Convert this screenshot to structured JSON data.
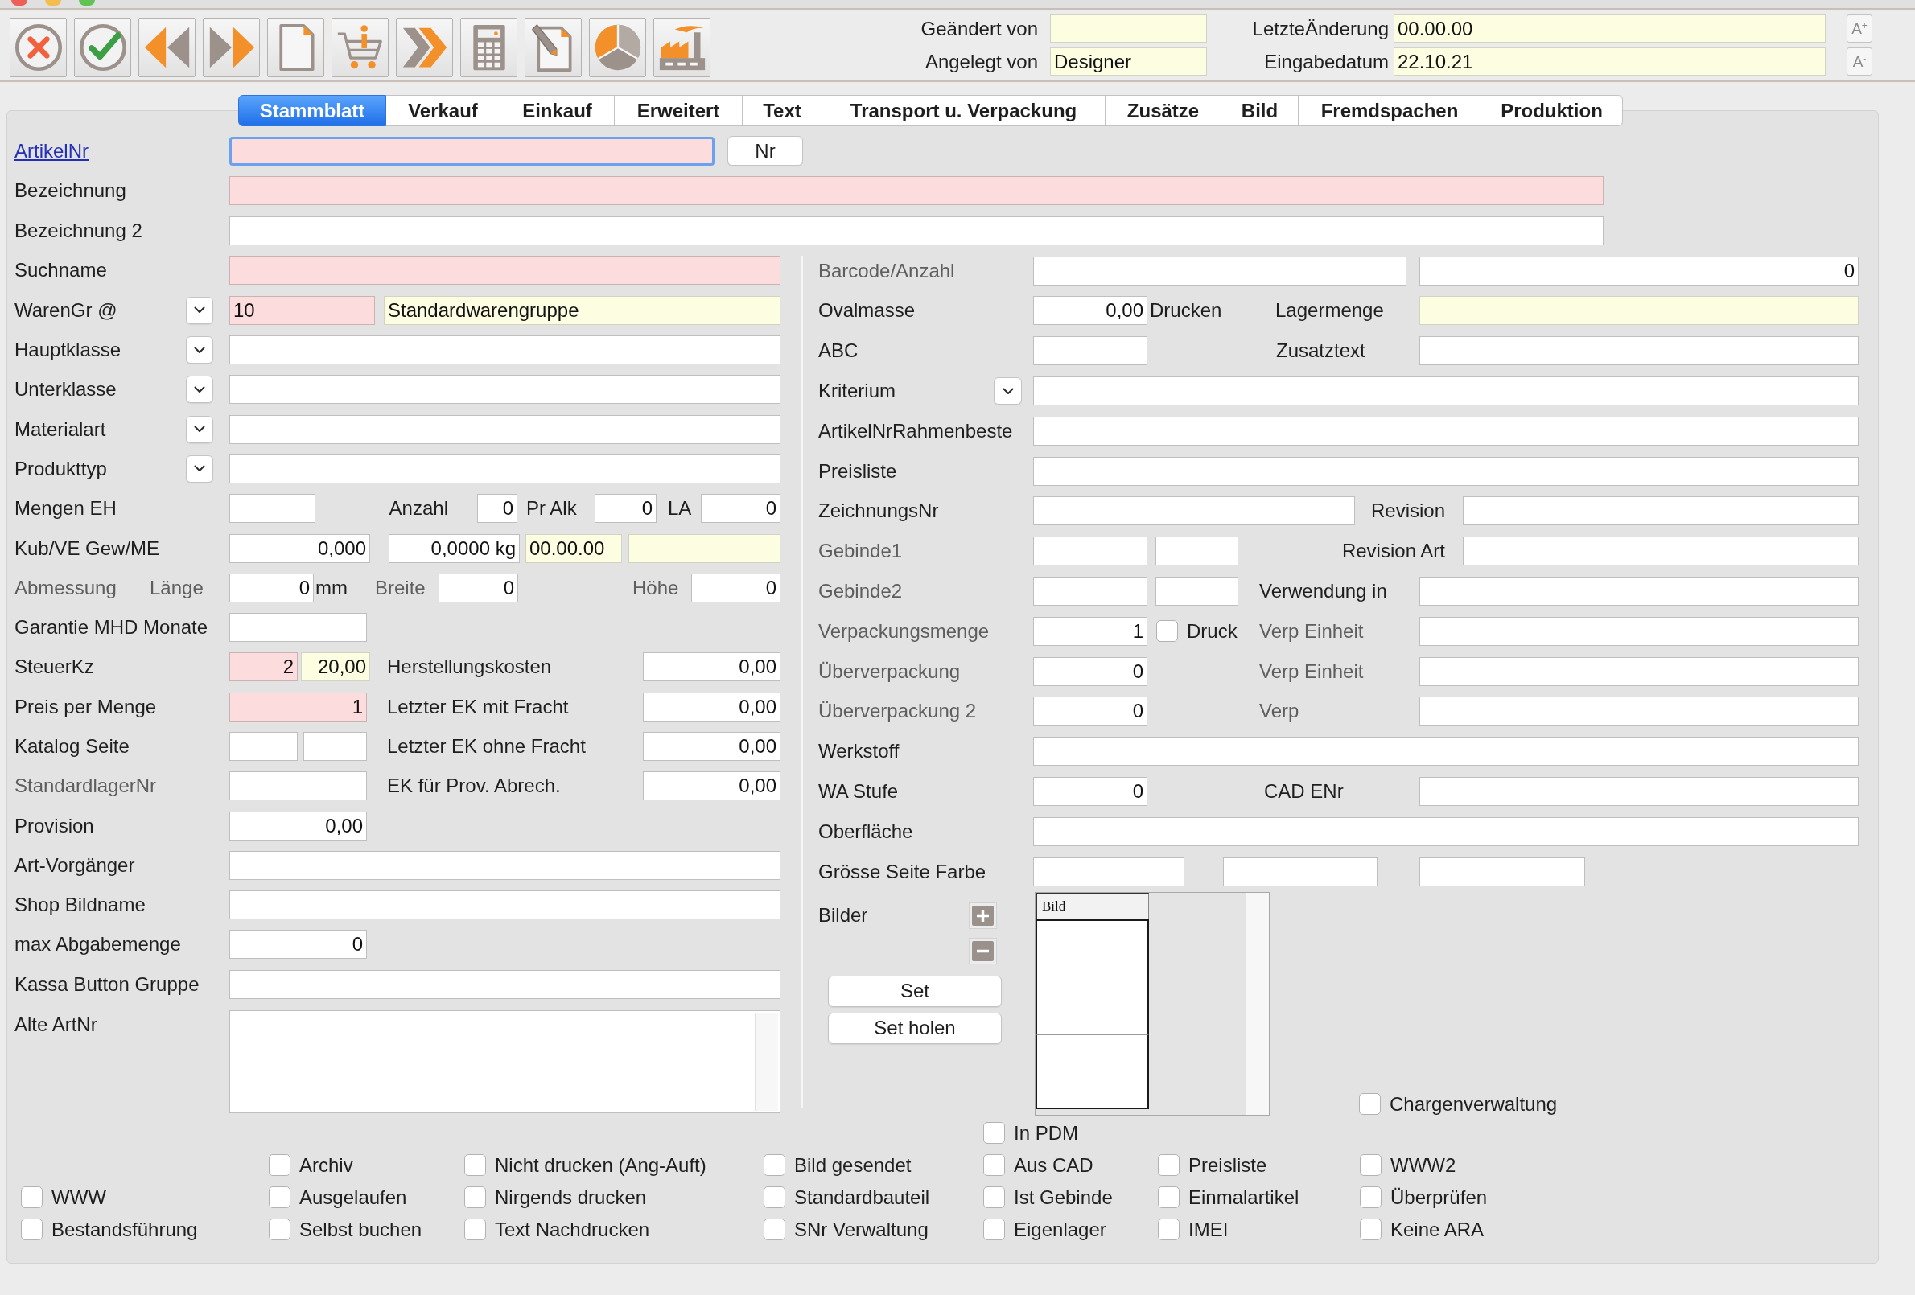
{
  "toolbar": [
    {
      "kind": "cancel"
    },
    {
      "kind": "confirm"
    },
    {
      "kind": "back"
    },
    {
      "kind": "forward"
    },
    {
      "kind": "new"
    },
    {
      "kind": "shop"
    },
    {
      "kind": "next"
    },
    {
      "kind": "calculator"
    },
    {
      "kind": "edit"
    },
    {
      "kind": "chart"
    },
    {
      "kind": "production"
    }
  ],
  "record_info": [
    [
      {
        "label": "Geändert von",
        "readonly": true
      },
      {
        "label": "LetzteÄnderung",
        "value": "00.00.00",
        "readonly": true
      }
    ],
    [
      {
        "label": "Angelegt von",
        "value": "Designer",
        "readonly": true
      },
      {
        "label": "Eingabedatum",
        "value": "22.10.21",
        "readonly": true
      }
    ]
  ],
  "font_buttons": [
    "A$^{+}$",
    "A$^{-}$"
  ],
  "tabs": [
    {
      "label": "Stammblatt",
      "selected": true
    },
    {
      "label": "Verkauf",
      "selected": false
    },
    {
      "label": "Einkauf",
      "selected": false
    },
    {
      "label": "Erweitert",
      "selected": false
    },
    {
      "label": "Text",
      "selected": false
    },
    {
      "label": "Transport u. Verpackung",
      "selected": false
    },
    {
      "label": "Zusätze",
      "selected": false
    },
    {
      "label": "Bild",
      "selected": false
    },
    {
      "label": "Fremdspachen",
      "selected": false
    },
    {
      "label": "Produktion",
      "selected": false
    }
  ],
  "form": {
    "top_rows": [
      {
        "items": [
          {
            "kind": "link",
            "text": "ArtikelNr"
          },
          {
            "kind": "text",
            "required": true,
            "readonly": false,
            "focused": true
          },
          {
            "kind": "button",
            "label": "Nr"
          }
        ]
      },
      {
        "items": [
          {
            "kind": "label",
            "text": "Bezeichnung",
            "dim": false
          },
          {
            "kind": "text",
            "required": true,
            "readonly": false
          }
        ]
      },
      {
        "items": [
          {
            "kind": "label",
            "text": "Bezeichnung 2",
            "dim": false
          },
          {
            "kind": "text",
            "required": false,
            "readonly": false
          }
        ]
      }
    ],
    "left_rows": [
      {
        "items": [
          {
            "kind": "label",
            "text": "Suchname",
            "dim": false
          },
          {
            "kind": "text",
            "required": true,
            "readonly": false
          }
        ]
      },
      {
        "items": [
          {
            "kind": "label",
            "text": "WarenGr @",
            "dim": false
          },
          {
            "kind": "dropdown"
          },
          {
            "kind": "text",
            "value": "10",
            "required": true,
            "readonly": false
          },
          {
            "kind": "text",
            "value": "Standardwarengruppe",
            "required": false,
            "readonly": true
          }
        ]
      },
      {
        "items": [
          {
            "kind": "label",
            "text": "Hauptklasse",
            "dim": false
          },
          {
            "kind": "dropdown"
          },
          {
            "kind": "text",
            "required": false,
            "readonly": false
          }
        ]
      },
      {
        "items": [
          {
            "kind": "label",
            "text": "Unterklasse",
            "dim": false
          },
          {
            "kind": "dropdown"
          },
          {
            "kind": "text",
            "required": false,
            "readonly": false
          }
        ]
      },
      {
        "items": [
          {
            "kind": "label",
            "text": "Materialart",
            "dim": false
          },
          {
            "kind": "dropdown"
          },
          {
            "kind": "text",
            "required": false,
            "readonly": false
          }
        ]
      },
      {
        "items": [
          {
            "kind": "label",
            "text": "Produkttyp",
            "dim": false
          },
          {
            "kind": "dropdown"
          },
          {
            "kind": "text",
            "required": false,
            "readonly": false
          }
        ]
      },
      {
        "items": [
          {
            "kind": "label",
            "text": "Mengen EH",
            "dim": false
          },
          {
            "kind": "text",
            "required": false,
            "readonly": false
          },
          {
            "kind": "label",
            "text": "Anzahl",
            "dim": false
          },
          {
            "kind": "number",
            "value": "0",
            "required": false,
            "readonly": false
          },
          {
            "kind": "label",
            "text": "Pr Alk",
            "dim": false
          },
          {
            "kind": "number",
            "value": "0",
            "required": false,
            "readonly": false
          },
          {
            "kind": "label",
            "text": "LA",
            "dim": false
          },
          {
            "kind": "number",
            "value": "0",
            "required": false,
            "readonly": false
          }
        ]
      },
      {
        "items": [
          {
            "kind": "label",
            "text": "Kub/VE Gew/ME",
            "dim": false
          },
          {
            "kind": "number",
            "value": "0,000",
            "required": false,
            "readonly": false
          },
          {
            "kind": "number",
            "value": "0,0000 kg",
            "required": false,
            "readonly": false
          },
          {
            "kind": "text",
            "value": "00.00.00",
            "required": false,
            "readonly": true
          },
          {
            "kind": "text",
            "required": false,
            "readonly": true
          }
        ]
      },
      {
        "items": [
          {
            "kind": "label",
            "text": "Abmessung",
            "dim": true
          },
          {
            "kind": "label",
            "text": "Länge",
            "dim": true
          },
          {
            "kind": "number",
            "value": "0",
            "required": false,
            "readonly": false
          },
          {
            "kind": "label",
            "text": "mm",
            "dim": false
          },
          {
            "kind": "label",
            "text": "Breite",
            "dim": true
          },
          {
            "kind": "number",
            "value": "0",
            "required": false,
            "readonly": false
          },
          {
            "kind": "label",
            "text": "Höhe",
            "dim": true
          },
          {
            "kind": "number",
            "value": "0",
            "required": false,
            "readonly": false
          }
        ]
      },
      {
        "items": [
          {
            "kind": "label",
            "text": "Garantie MHD Monate",
            "dim": false
          },
          {
            "kind": "text",
            "required": false,
            "readonly": false
          }
        ]
      },
      {
        "items": [
          {
            "kind": "label",
            "text": "SteuerKz",
            "dim": false
          },
          {
            "kind": "number",
            "value": "2",
            "required": true,
            "readonly": false
          },
          {
            "kind": "number",
            "value": "20,00",
            "required": false,
            "readonly": true
          },
          {
            "kind": "label",
            "text": "Herstellungskosten",
            "dim": false
          },
          {
            "kind": "number",
            "value": "0,00",
            "required": false,
            "readonly": false
          }
        ]
      },
      {
        "items": [
          {
            "kind": "label",
            "text": "Preis per Menge",
            "dim": false
          },
          {
            "kind": "number",
            "value": "1",
            "required": true,
            "readonly": false
          },
          {
            "kind": "label",
            "text": "Letzter EK mit Fracht",
            "dim": false
          },
          {
            "kind": "number",
            "value": "0,00",
            "required": false,
            "readonly": false
          }
        ]
      },
      {
        "items": [
          {
            "kind": "label",
            "text": "Katalog Seite",
            "dim": false
          },
          {
            "kind": "text",
            "required": false,
            "readonly": false
          },
          {
            "kind": "text",
            "required": false,
            "readonly": false
          },
          {
            "kind": "label",
            "text": "Letzter EK ohne Fracht",
            "dim": false
          },
          {
            "kind": "number",
            "value": "0,00",
            "required": false,
            "readonly": false
          }
        ]
      },
      {
        "items": [
          {
            "kind": "label",
            "text": "StandardlagerNr",
            "dim": true
          },
          {
            "kind": "text",
            "required": false,
            "readonly": false
          },
          {
            "kind": "label",
            "text": "EK für Prov. Abrech.",
            "dim": false
          },
          {
            "kind": "number",
            "value": "0,00",
            "required": false,
            "readonly": false
          }
        ]
      },
      {
        "items": [
          {
            "kind": "label",
            "text": "Provision",
            "dim": false
          },
          {
            "kind": "number",
            "value": "0,00",
            "required": false,
            "readonly": false
          }
        ]
      },
      {
        "items": [
          {
            "kind": "label",
            "text": "Art-Vorgänger",
            "dim": false
          },
          {
            "kind": "text",
            "required": false,
            "readonly": false
          }
        ]
      },
      {
        "items": [
          {
            "kind": "label",
            "text": "Shop Bildname",
            "dim": false
          },
          {
            "kind": "text",
            "required": false,
            "readonly": false
          }
        ]
      },
      {
        "items": [
          {
            "kind": "label",
            "text": "max Abgabemenge",
            "dim": false
          },
          {
            "kind": "number",
            "value": "0",
            "required": false,
            "readonly": false
          }
        ]
      },
      {
        "items": [
          {
            "kind": "label",
            "text": "Kassa Button Gruppe",
            "dim": false
          },
          {
            "kind": "text",
            "required": false,
            "readonly": false
          }
        ]
      },
      {
        "items": [
          {
            "kind": "label",
            "text": "Alte ArtNr",
            "dim": false
          },
          {
            "kind": "textarea",
            "required": false,
            "readonly": false
          }
        ]
      }
    ],
    "right_rows": [
      {
        "items": [
          {
            "kind": "label",
            "text": "Barcode/Anzahl",
            "dim": true
          },
          {
            "kind": "text",
            "required": false,
            "readonly": false
          },
          {
            "kind": "number",
            "value": "0",
            "required": false,
            "readonly": false
          }
        ]
      },
      {
        "items": [
          {
            "kind": "label",
            "text": "Ovalmasse",
            "dim": false
          },
          {
            "kind": "number",
            "value": "0,00",
            "required": false,
            "readonly": false
          },
          {
            "kind": "label",
            "text": "Drucken",
            "dim": false
          },
          {
            "kind": "label",
            "text": "Lagermenge",
            "dim": false
          },
          {
            "kind": "text",
            "required": false,
            "readonly": true
          }
        ]
      },
      {
        "items": [
          {
            "kind": "label",
            "text": "ABC",
            "dim": false
          },
          {
            "kind": "text",
            "required": false,
            "readonly": false
          },
          {
            "kind": "label",
            "text": "Zusatztext",
            "dim": false
          },
          {
            "kind": "text",
            "required": false,
            "readonly": false
          }
        ]
      },
      {
        "items": [
          {
            "kind": "label",
            "text": "Kriterium",
            "dim": false
          },
          {
            "kind": "dropdown"
          },
          {
            "kind": "text",
            "required": false,
            "readonly": false
          }
        ]
      },
      {
        "items": [
          {
            "kind": "label",
            "text": "ArtikelNrRahmenbeste",
            "dim": false
          },
          {
            "kind": "text",
            "required": false,
            "readonly": false
          }
        ]
      },
      {
        "items": [
          {
            "kind": "label",
            "text": "Preisliste",
            "dim": false
          },
          {
            "kind": "text",
            "required": false,
            "readonly": false
          }
        ]
      },
      {
        "items": [
          {
            "kind": "label",
            "text": "ZeichnungsNr",
            "dim": false
          },
          {
            "kind": "text",
            "required": false,
            "readonly": false
          },
          {
            "kind": "label",
            "text": "Revision",
            "dim": false
          },
          {
            "kind": "text",
            "required": false,
            "readonly": false
          }
        ]
      },
      {
        "items": [
          {
            "kind": "label",
            "text": "Gebinde1",
            "dim": true
          },
          {
            "kind": "text",
            "required": false,
            "readonly": false
          },
          {
            "kind": "text",
            "required": false,
            "readonly": false
          },
          {
            "kind": "label",
            "text": "Revision Art",
            "dim": false
          },
          {
            "kind": "text",
            "required": false,
            "readonly": false
          }
        ]
      },
      {
        "items": [
          {
            "kind": "label",
            "text": "Gebinde2",
            "dim": true
          },
          {
            "kind": "text",
            "required": false,
            "readonly": false
          },
          {
            "kind": "text",
            "required": false,
            "readonly": false
          },
          {
            "kind": "label",
            "text": "Verwendung in",
            "dim": false
          },
          {
            "kind": "text",
            "required": false,
            "readonly": false
          }
        ]
      },
      {
        "items": [
          {
            "kind": "label",
            "text": "Verpackungsmenge",
            "dim": true
          },
          {
            "kind": "number",
            "value": "1",
            "required": false,
            "readonly": false
          },
          {
            "kind": "checkbox",
            "label": "Druck",
            "checked": false
          },
          {
            "kind": "label",
            "text": "Verp Einheit",
            "dim": true
          },
          {
            "kind": "text",
            "required": false,
            "readonly": false
          }
        ]
      },
      {
        "items": [
          {
            "kind": "label",
            "text": "Überverpackung",
            "dim": true
          },
          {
            "kind": "number",
            "value": "0",
            "required": false,
            "readonly": false
          },
          {
            "kind": "label",
            "text": "Verp Einheit",
            "dim": true
          },
          {
            "kind": "text",
            "required": false,
            "readonly": false
          }
        ]
      },
      {
        "items": [
          {
            "kind": "label",
            "text": "Überverpackung 2",
            "dim": true
          },
          {
            "kind": "number",
            "value": "0",
            "required": false,
            "readonly": false
          },
          {
            "kind": "label",
            "text": "Verp",
            "dim": true
          },
          {
            "kind": "text",
            "required": false,
            "readonly": false
          }
        ]
      },
      {
        "items": [
          {
            "kind": "label",
            "text": "Werkstoff",
            "dim": false
          },
          {
            "kind": "text",
            "required": false,
            "readonly": false
          }
        ]
      },
      {
        "items": [
          {
            "kind": "label",
            "text": "WA Stufe",
            "dim": false
          },
          {
            "kind": "number",
            "value": "0",
            "required": false,
            "readonly": false
          },
          {
            "kind": "label",
            "text": "CAD ENr",
            "dim": false
          },
          {
            "kind": "text",
            "required": false,
            "readonly": false
          }
        ]
      },
      {
        "items": [
          {
            "kind": "label",
            "text": "Oberfläche",
            "dim": false
          },
          {
            "kind": "text",
            "required": false,
            "readonly": false
          }
        ]
      },
      {
        "items": [
          {
            "kind": "label",
            "text": "Grösse Seite Farbe",
            "dim": false
          },
          {
            "kind": "text",
            "required": false,
            "readonly": false
          },
          {
            "kind": "text",
            "required": false,
            "readonly": false
          },
          {
            "kind": "text",
            "required": false,
            "readonly": false
          }
        ]
      }
    ]
  },
  "images": {
    "label": "Bilder",
    "actions": [
      {
        "kind": "add"
      },
      {
        "kind": "remove"
      }
    ],
    "buttons": [
      {
        "label": "Set"
      },
      {
        "label": "Set holen"
      }
    ],
    "column": "Bild"
  },
  "batch_option": {
    "label": "Chargenverwaltung",
    "checked": false
  },
  "options": [
    [
      {
        "label": "WWW",
        "checked": false
      },
      {
        "label": "Bestandsführung",
        "checked": false
      }
    ],
    [
      {
        "label": "Archiv",
        "checked": false
      },
      {
        "label": "Ausgelaufen",
        "checked": false
      },
      {
        "label": "Selbst buchen",
        "checked": false
      }
    ],
    [
      {
        "label": "Nicht drucken (Ang-Auft)",
        "checked": false
      },
      {
        "label": "Nirgends drucken",
        "checked": false
      },
      {
        "label": "Text Nachdrucken",
        "checked": false
      }
    ],
    [
      {
        "label": "Bild gesendet",
        "checked": false
      },
      {
        "label": "Standardbauteil",
        "checked": false
      },
      {
        "label": "SNr Verwaltung",
        "checked": false
      }
    ],
    [
      {
        "label": "In PDM",
        "checked": false
      },
      {
        "label": "Aus CAD",
        "checked": false
      },
      {
        "label": "Ist Gebinde",
        "checked": false
      },
      {
        "label": "Eigenlager",
        "checked": false
      }
    ],
    [
      {
        "label": "Preisliste",
        "checked": false
      },
      {
        "label": "Einmalartikel",
        "checked": false
      },
      {
        "label": "IMEI",
        "checked": false
      }
    ],
    [
      {
        "label": "WWW2",
        "checked": false
      },
      {
        "label": "Überprüfen",
        "checked": false
      },
      {
        "label": "Keine ARA",
        "checked": false
      }
    ]
  ]
}
